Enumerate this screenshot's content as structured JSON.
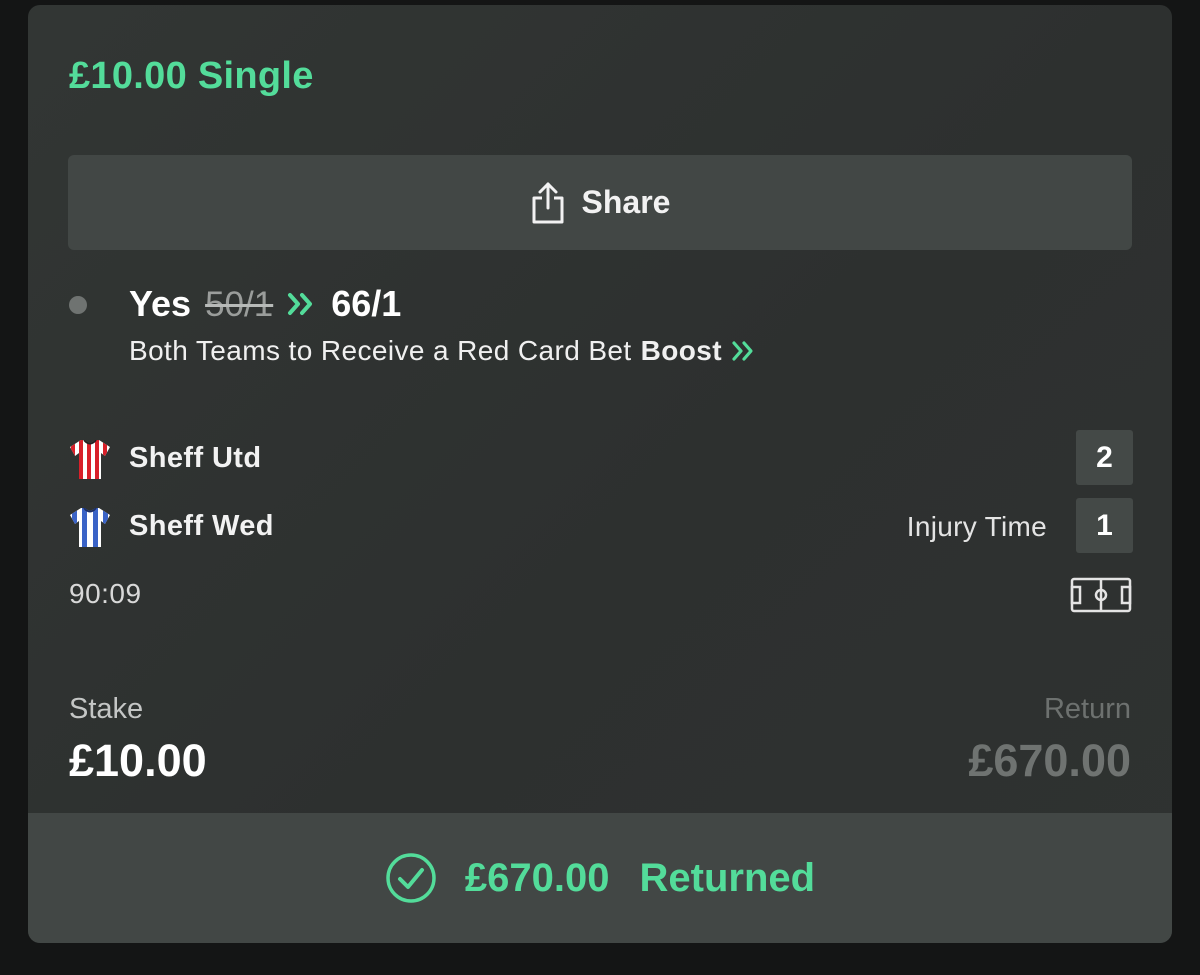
{
  "bet": {
    "title": "£10.00 Single",
    "share_label": "Share",
    "selection": {
      "name": "Yes",
      "old_odds": "50/1",
      "new_odds": "66/1",
      "market": "Both Teams to Receive a Red Card Bet",
      "boost_label": "Boost"
    },
    "match": {
      "home": {
        "name": "Sheff Utd",
        "score": "2"
      },
      "away": {
        "name": "Sheff Wed",
        "score": "1"
      },
      "period": "Injury Time",
      "clock": "90:09"
    },
    "stake_label": "Stake",
    "stake_value": "£10.00",
    "return_label": "Return",
    "return_value": "£670.00",
    "result_amount": "£670.00",
    "result_status": "Returned"
  },
  "colors": {
    "accent": "#53dc9a",
    "card_bg": "#303332",
    "button_bg": "#424745",
    "home_kit": "#d8202a",
    "away_kit": "#3a63c7"
  },
  "icons": {
    "share": "share-icon",
    "boost": "double-chevron-right-icon",
    "home_kit": "striped-shirt-icon",
    "away_kit": "striped-shirt-icon",
    "pitch": "football-pitch-icon",
    "check": "check-circle-icon"
  }
}
